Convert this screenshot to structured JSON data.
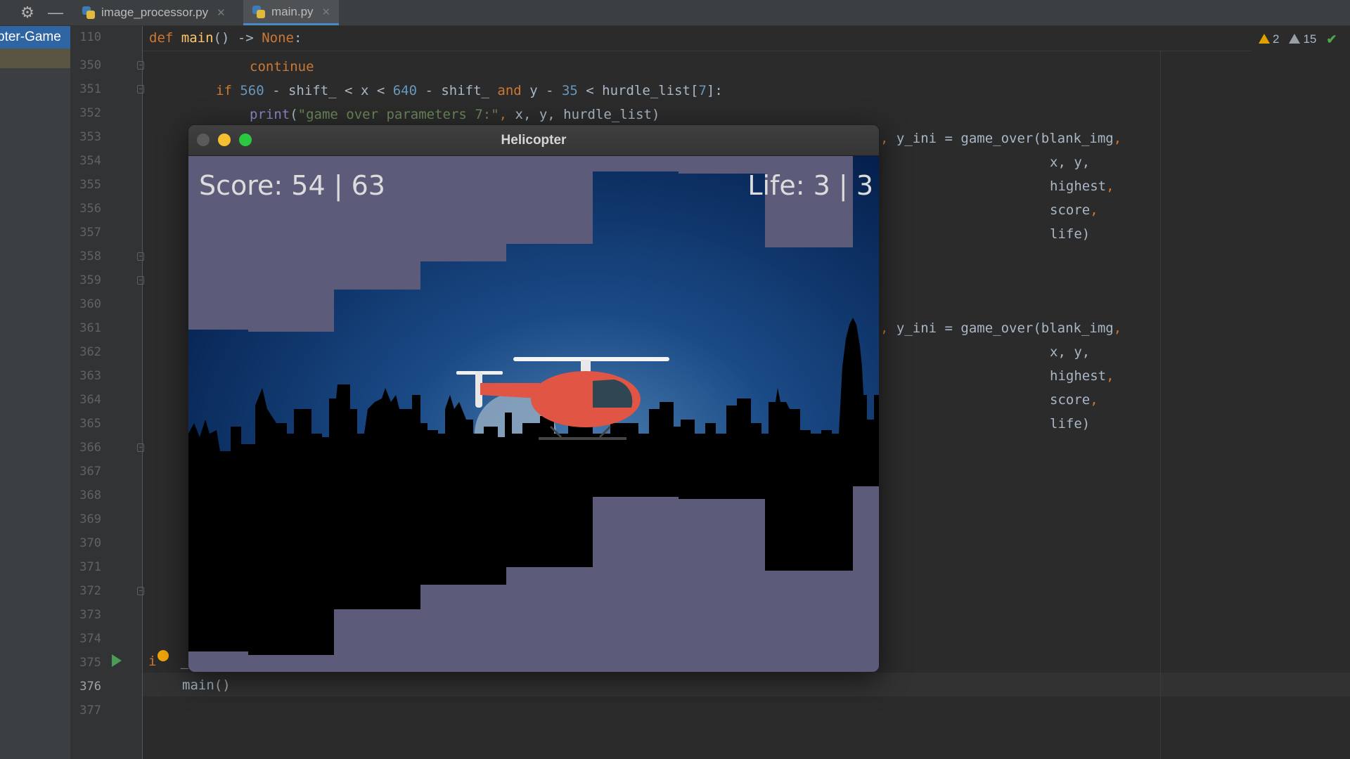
{
  "tabs": [
    {
      "label": "image_processor.py",
      "active": false
    },
    {
      "label": "main.py",
      "active": true
    }
  ],
  "project": {
    "label": "pter-Game"
  },
  "editor": {
    "sticky_line": "110",
    "line_numbers": [
      "350",
      "351",
      "352",
      "353",
      "354",
      "355",
      "356",
      "357",
      "358",
      "359",
      "360",
      "361",
      "362",
      "363",
      "364",
      "365",
      "366",
      "367",
      "368",
      "369",
      "370",
      "371",
      "372",
      "373",
      "374",
      "375",
      "376",
      "377"
    ],
    "current_line": "376",
    "code": {
      "sticky_def": "def",
      "sticky_main": "main",
      "sticky_sig": "() -> ",
      "sticky_none": "None",
      "sticky_colon": ":",
      "l350": "continue",
      "l351_if": "if",
      "l351_560": "560",
      "l351_a": " - shift_ < x < ",
      "l351_640": "640",
      "l351_b": " - shift_ ",
      "l351_and": "and",
      "l351_c": " y - ",
      "l351_35": "35",
      "l351_d": " < hurdle_list[",
      "l351_7": "7",
      "l351_e": "]:",
      "l352_print": "print",
      "l352_open": "(",
      "l352_str": "\"game over parameters 7:\"",
      "l352_comma": ", ",
      "l352_rest": "x, y, hurdle_list)",
      "go_prefix": ",",
      "go_text": " y_ini = game_over(blank_img",
      "go_comma": ",",
      "arg_xy": "x, y,",
      "arg_highest": "highest",
      "arg_score": "score",
      "arg_life": "life)",
      "comma": ",",
      "l375": "i",
      "l375_tail": "_",
      "l376": "main()"
    }
  },
  "inspections": {
    "warnings": "2",
    "weak_warnings": "15"
  },
  "game": {
    "window_title": "Helicopter",
    "score_text": "Score: 54 | 63",
    "life_text": "Life: 3 | 3",
    "colors": {
      "cave_wall": "#5c5c7a",
      "sky_top": "#001640",
      "sky_glow": "#35689c",
      "helicopter": "#e05544",
      "skyline": "#000000"
    }
  },
  "icons": [
    "settings-icon",
    "minimize-icon",
    "python-file-icon",
    "close-icon",
    "run-icon",
    "bulb-icon",
    "warning-icon",
    "check-icon"
  ]
}
